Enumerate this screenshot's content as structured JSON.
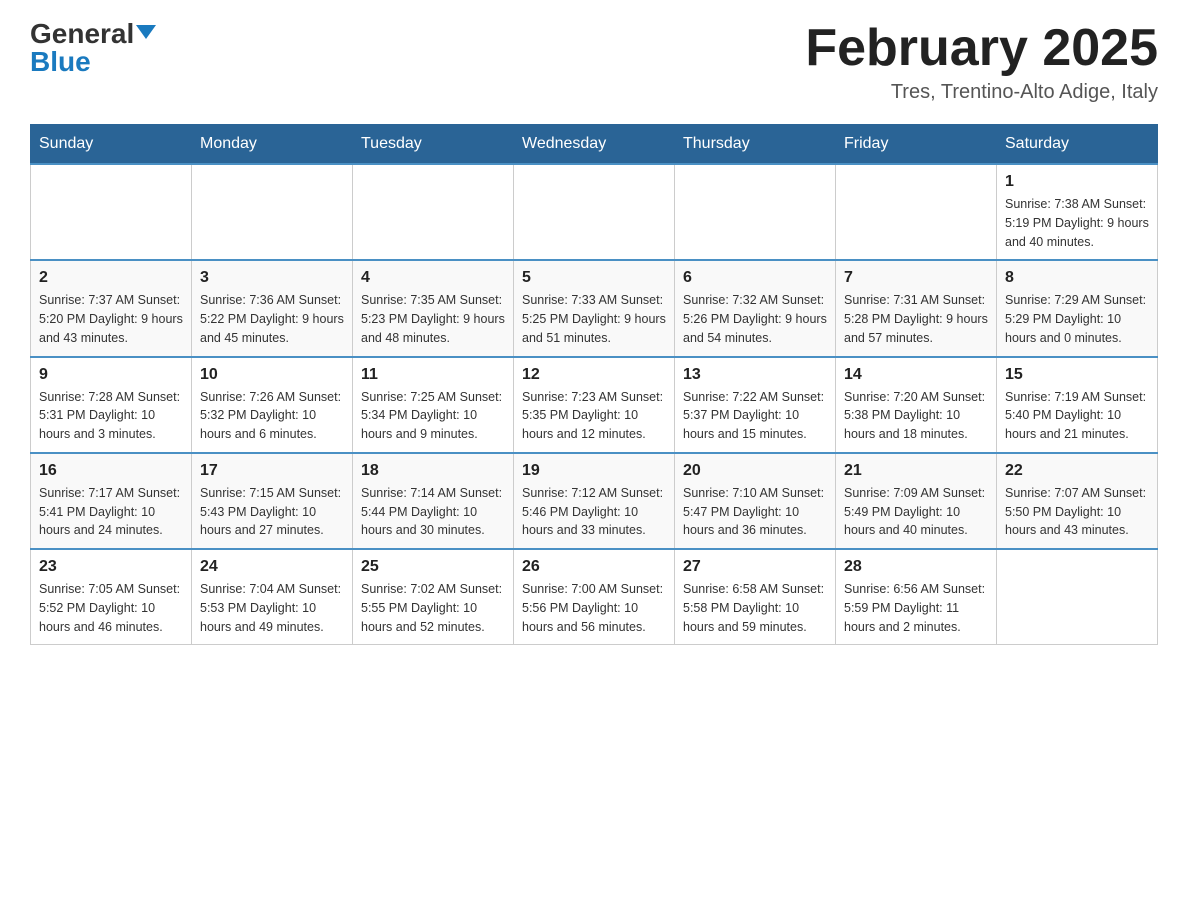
{
  "header": {
    "logo_general": "General",
    "logo_blue": "Blue",
    "month_title": "February 2025",
    "location": "Tres, Trentino-Alto Adige, Italy"
  },
  "days_of_week": [
    "Sunday",
    "Monday",
    "Tuesday",
    "Wednesday",
    "Thursday",
    "Friday",
    "Saturday"
  ],
  "weeks": [
    [
      {
        "day": "",
        "info": ""
      },
      {
        "day": "",
        "info": ""
      },
      {
        "day": "",
        "info": ""
      },
      {
        "day": "",
        "info": ""
      },
      {
        "day": "",
        "info": ""
      },
      {
        "day": "",
        "info": ""
      },
      {
        "day": "1",
        "info": "Sunrise: 7:38 AM\nSunset: 5:19 PM\nDaylight: 9 hours and 40 minutes."
      }
    ],
    [
      {
        "day": "2",
        "info": "Sunrise: 7:37 AM\nSunset: 5:20 PM\nDaylight: 9 hours and 43 minutes."
      },
      {
        "day": "3",
        "info": "Sunrise: 7:36 AM\nSunset: 5:22 PM\nDaylight: 9 hours and 45 minutes."
      },
      {
        "day": "4",
        "info": "Sunrise: 7:35 AM\nSunset: 5:23 PM\nDaylight: 9 hours and 48 minutes."
      },
      {
        "day": "5",
        "info": "Sunrise: 7:33 AM\nSunset: 5:25 PM\nDaylight: 9 hours and 51 minutes."
      },
      {
        "day": "6",
        "info": "Sunrise: 7:32 AM\nSunset: 5:26 PM\nDaylight: 9 hours and 54 minutes."
      },
      {
        "day": "7",
        "info": "Sunrise: 7:31 AM\nSunset: 5:28 PM\nDaylight: 9 hours and 57 minutes."
      },
      {
        "day": "8",
        "info": "Sunrise: 7:29 AM\nSunset: 5:29 PM\nDaylight: 10 hours and 0 minutes."
      }
    ],
    [
      {
        "day": "9",
        "info": "Sunrise: 7:28 AM\nSunset: 5:31 PM\nDaylight: 10 hours and 3 minutes."
      },
      {
        "day": "10",
        "info": "Sunrise: 7:26 AM\nSunset: 5:32 PM\nDaylight: 10 hours and 6 minutes."
      },
      {
        "day": "11",
        "info": "Sunrise: 7:25 AM\nSunset: 5:34 PM\nDaylight: 10 hours and 9 minutes."
      },
      {
        "day": "12",
        "info": "Sunrise: 7:23 AM\nSunset: 5:35 PM\nDaylight: 10 hours and 12 minutes."
      },
      {
        "day": "13",
        "info": "Sunrise: 7:22 AM\nSunset: 5:37 PM\nDaylight: 10 hours and 15 minutes."
      },
      {
        "day": "14",
        "info": "Sunrise: 7:20 AM\nSunset: 5:38 PM\nDaylight: 10 hours and 18 minutes."
      },
      {
        "day": "15",
        "info": "Sunrise: 7:19 AM\nSunset: 5:40 PM\nDaylight: 10 hours and 21 minutes."
      }
    ],
    [
      {
        "day": "16",
        "info": "Sunrise: 7:17 AM\nSunset: 5:41 PM\nDaylight: 10 hours and 24 minutes."
      },
      {
        "day": "17",
        "info": "Sunrise: 7:15 AM\nSunset: 5:43 PM\nDaylight: 10 hours and 27 minutes."
      },
      {
        "day": "18",
        "info": "Sunrise: 7:14 AM\nSunset: 5:44 PM\nDaylight: 10 hours and 30 minutes."
      },
      {
        "day": "19",
        "info": "Sunrise: 7:12 AM\nSunset: 5:46 PM\nDaylight: 10 hours and 33 minutes."
      },
      {
        "day": "20",
        "info": "Sunrise: 7:10 AM\nSunset: 5:47 PM\nDaylight: 10 hours and 36 minutes."
      },
      {
        "day": "21",
        "info": "Sunrise: 7:09 AM\nSunset: 5:49 PM\nDaylight: 10 hours and 40 minutes."
      },
      {
        "day": "22",
        "info": "Sunrise: 7:07 AM\nSunset: 5:50 PM\nDaylight: 10 hours and 43 minutes."
      }
    ],
    [
      {
        "day": "23",
        "info": "Sunrise: 7:05 AM\nSunset: 5:52 PM\nDaylight: 10 hours and 46 minutes."
      },
      {
        "day": "24",
        "info": "Sunrise: 7:04 AM\nSunset: 5:53 PM\nDaylight: 10 hours and 49 minutes."
      },
      {
        "day": "25",
        "info": "Sunrise: 7:02 AM\nSunset: 5:55 PM\nDaylight: 10 hours and 52 minutes."
      },
      {
        "day": "26",
        "info": "Sunrise: 7:00 AM\nSunset: 5:56 PM\nDaylight: 10 hours and 56 minutes."
      },
      {
        "day": "27",
        "info": "Sunrise: 6:58 AM\nSunset: 5:58 PM\nDaylight: 10 hours and 59 minutes."
      },
      {
        "day": "28",
        "info": "Sunrise: 6:56 AM\nSunset: 5:59 PM\nDaylight: 11 hours and 2 minutes."
      },
      {
        "day": "",
        "info": ""
      }
    ]
  ]
}
